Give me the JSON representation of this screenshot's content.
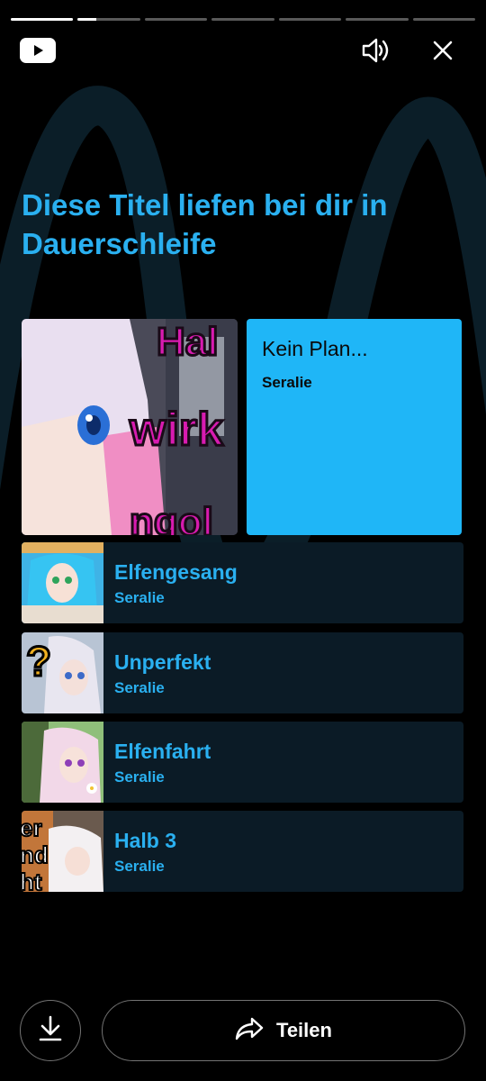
{
  "story": {
    "segments": [
      {
        "progress": 1.0
      },
      {
        "progress": 0.3
      },
      {
        "progress": 0
      },
      {
        "progress": 0
      },
      {
        "progress": 0
      },
      {
        "progress": 0
      },
      {
        "progress": 0
      }
    ]
  },
  "header": {
    "logo_icon": "youtube-logo-icon",
    "sound_icon": "volume-icon",
    "close_icon": "close-icon"
  },
  "headline": "Diese Titel liefen bei dir in Dauerschleife",
  "top_track": {
    "title": "Kein Plan...",
    "artist": "Seralie"
  },
  "tracks": [
    {
      "title": "Elfengesang",
      "artist": "Seralie"
    },
    {
      "title": "Unperfekt",
      "artist": "Seralie"
    },
    {
      "title": "Elfenfahrt",
      "artist": "Seralie"
    },
    {
      "title": "Halb 3",
      "artist": "Seralie"
    }
  ],
  "footer": {
    "download_icon": "download-icon",
    "share_icon": "share-icon",
    "share_label": "Teilen"
  },
  "colors": {
    "accent": "#2ab0f0",
    "card_bg": "#1fb6f7",
    "row_bg": "#0b1b26"
  }
}
